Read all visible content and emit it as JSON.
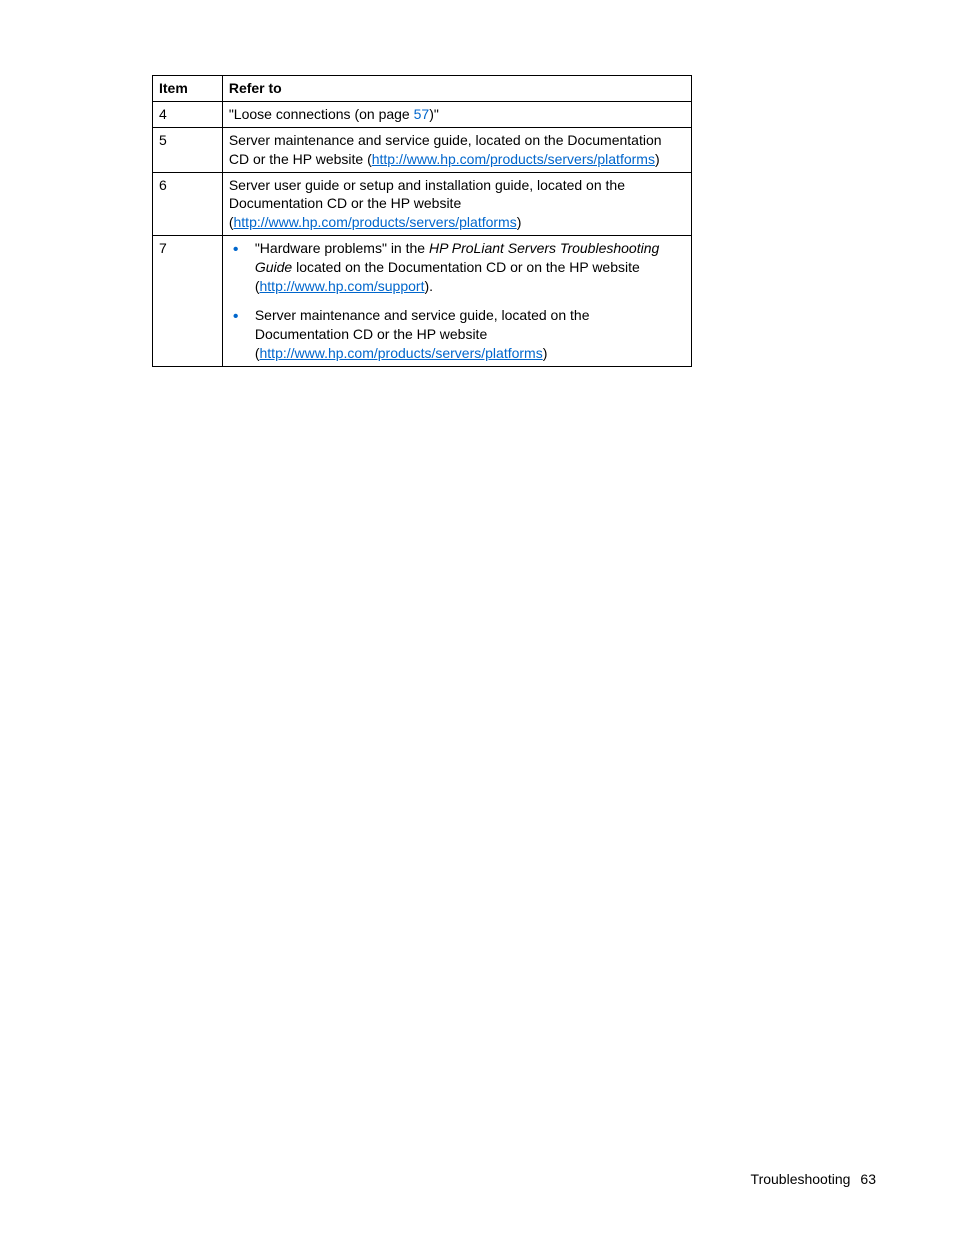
{
  "table": {
    "headers": {
      "item": "Item",
      "refer_to": "Refer to"
    },
    "rows": [
      {
        "item": "4",
        "text_before": "\"Loose connections (on page ",
        "pageref": "57",
        "text_after": ")\""
      },
      {
        "item": "5",
        "text_before": "Server maintenance and service guide, located on the Documentation CD or the HP website (",
        "link": "http://www.hp.com/products/servers/platforms",
        "text_after": ")"
      },
      {
        "item": "6",
        "text_before": "Server user guide or setup and installation guide, located on the Documentation CD or the HP website (",
        "link": "http://www.hp.com/products/servers/platforms",
        "text_after": ")"
      },
      {
        "item": "7",
        "bullets": [
          {
            "text1": "\"Hardware problems\" in the ",
            "italic": "HP ProLiant Servers Troubleshooting Guide",
            "text2": " located on the Documentation CD or on the HP website (",
            "link": "http://www.hp.com/support",
            "text3": ")."
          },
          {
            "text1": "Server maintenance and service guide, located on the Documentation CD or the HP website (",
            "link": "http://www.hp.com/products/servers/platforms",
            "text3": ")"
          }
        ]
      }
    ]
  },
  "footer": {
    "section": "Troubleshooting",
    "page": "63"
  }
}
